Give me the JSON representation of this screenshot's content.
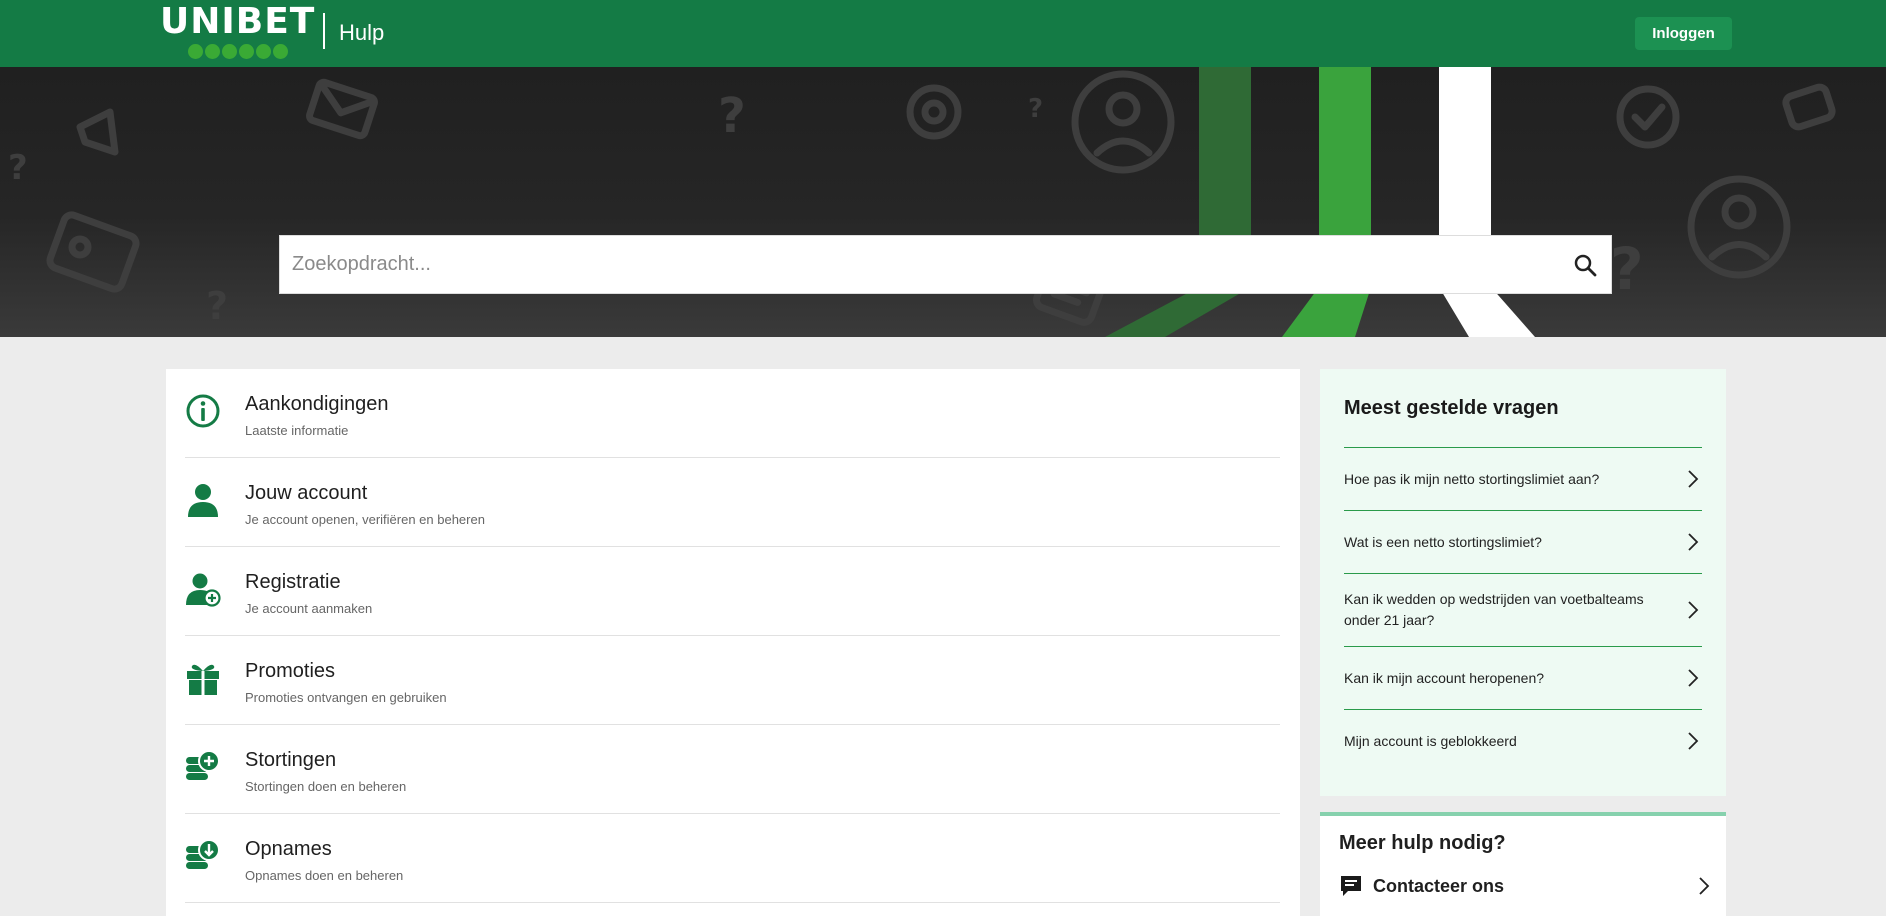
{
  "header": {
    "logo_text": "UNIBET",
    "title": "Hulp",
    "login_label": "Inloggen",
    "brand_color": "#147b45"
  },
  "search": {
    "placeholder": "Zoekopdracht...",
    "icon": "search-icon"
  },
  "categories": [
    {
      "title": "Aankondigingen",
      "subtitle": "Laatste informatie",
      "icon": "info-icon"
    },
    {
      "title": "Jouw account",
      "subtitle": "Je account openen, verifiëren en beheren",
      "icon": "user-icon"
    },
    {
      "title": "Registratie",
      "subtitle": "Je account aanmaken",
      "icon": "user-add-icon"
    },
    {
      "title": "Promoties",
      "subtitle": "Promoties ontvangen en gebruiken",
      "icon": "gift-icon"
    },
    {
      "title": "Stortingen",
      "subtitle": "Stortingen doen en beheren",
      "icon": "coins-plus-icon"
    },
    {
      "title": "Opnames",
      "subtitle": "Opnames doen en beheren",
      "icon": "coins-download-icon"
    }
  ],
  "faq": {
    "title": "Meest gestelde vragen",
    "items": [
      "Hoe pas ik mijn netto stortingslimiet aan?",
      "Wat is een netto stortingslimiet?",
      "Kan ik wedden op wedstrijden van voetbalteams onder 21 jaar?",
      "Kan ik mijn account heropenen?",
      "Mijn account is geblokkeerd"
    ]
  },
  "help_box": {
    "title": "Meer hulp nodig?",
    "contact_label": "Contacteer ons"
  }
}
